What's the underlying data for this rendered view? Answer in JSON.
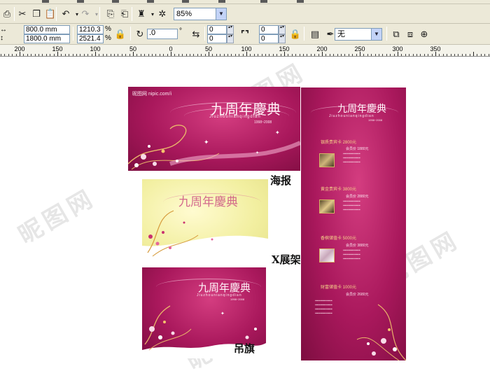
{
  "toolbar": {
    "zoom": "85%",
    "width_value": "800.0 mm",
    "height_value": "1800.0 mm",
    "scale_x": "1210.3",
    "scale_y": "2521.4",
    "percent_x": "%",
    "percent_y": "%",
    "rotation": ".0",
    "degree_symbol": "°",
    "spin_a": "0",
    "spin_b": "0",
    "spin_c": "0",
    "spin_d": "0",
    "outline": "无"
  },
  "ruler": {
    "labels": [
      "200",
      "150",
      "100",
      "50",
      "0",
      "50",
      "100",
      "150",
      "200",
      "250",
      "300",
      "350"
    ]
  },
  "canvas": {
    "captions": {
      "poster": "海报",
      "xbanner": "X展架",
      "flag": "吊旗"
    },
    "poster": {
      "site": "昵图网 nipic.com/i",
      "title": "九周年慶典",
      "pinyin": "Jiuzhounianqingdian",
      "years": "1998~2008"
    },
    "xbanner": {
      "title": "九周年慶典",
      "pinyin": "Jiuzhounianqingdian",
      "years": "1998~2008",
      "items": [
        "银质贵宾卡 2800元",
        "黄金贵宾卡 3800元",
        "香槟储值卡 5000元",
        "财富储值卡 1000元"
      ],
      "item_prices": [
        "会员价 1880元",
        "会员价 2880元",
        "会员价 3880元",
        "会员价 2680元"
      ]
    },
    "yellow": {
      "title": "九周年慶典"
    },
    "flag": {
      "title": "九周年慶典",
      "pinyin": "Jiuzhounianqingdian",
      "years": "1998~2008"
    },
    "watermark": "昵图网"
  }
}
